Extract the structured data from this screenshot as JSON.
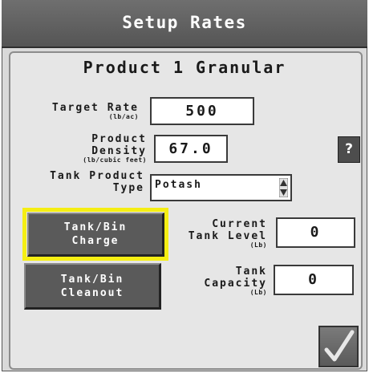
{
  "window": {
    "title": "Setup Rates"
  },
  "product": {
    "title": "Product 1 Granular"
  },
  "fields": {
    "target_rate": {
      "label": "Target Rate",
      "unit": "(lb/ac)",
      "value": "500"
    },
    "product_density": {
      "label_line1": "Product",
      "label_line2": "Density",
      "unit": "(lb/cubic feet)",
      "value": "67.0"
    },
    "tank_product_type": {
      "label_line1": "Tank Product",
      "label_line2": "Type",
      "value": "Potash"
    },
    "current_tank_level": {
      "label_line1": "Current",
      "label_line2": "Tank Level",
      "unit": "(Lb)",
      "value": "0"
    },
    "tank_capacity": {
      "label_line1": "Tank",
      "label_line2": "Capacity",
      "unit": "(Lb)",
      "value": "0"
    }
  },
  "buttons": {
    "tank_bin_charge": {
      "line1": "Tank/Bin",
      "line2": "Charge"
    },
    "tank_bin_cleanout": {
      "line1": "Tank/Bin",
      "line2": "Cleanout"
    },
    "help": "?",
    "confirm_icon": "checkmark-icon"
  },
  "colors": {
    "highlight": "#f5ee13",
    "button": "#5a5a5a",
    "panel": "#e6e6e6"
  }
}
